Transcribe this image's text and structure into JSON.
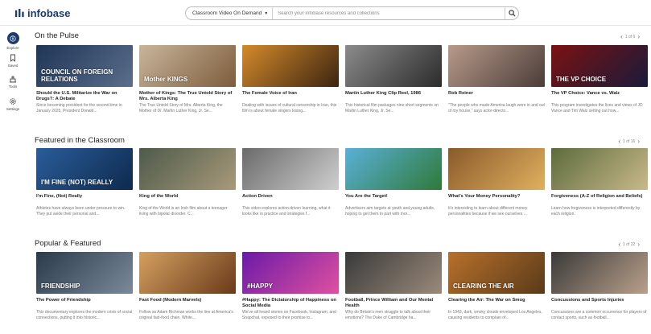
{
  "app": {
    "brand": "infobase"
  },
  "search": {
    "scope": "Classroom Video On Demand",
    "placeholder": "Search your Infobase resources and collections"
  },
  "sidebar": {
    "items": [
      {
        "label": "Explore",
        "icon": "compass-icon",
        "active": true
      },
      {
        "label": "Saved",
        "icon": "bookmark-icon",
        "active": false
      },
      {
        "label": "Tools",
        "icon": "tools-icon",
        "active": false
      },
      {
        "label": "Settings",
        "icon": "gear-icon",
        "active": false
      }
    ]
  },
  "sections": [
    {
      "title": "On the Pulse",
      "pager": "1 of 6",
      "cards": [
        {
          "title": "Should the U.S. Militarize the War on Drugs?: A Debate",
          "desc": "Since becoming president for the second time in January 2025, President Donald...",
          "colors": [
            "#1f3556",
            "#5b6f8c"
          ],
          "overlay": "COUNCIL ON FOREIGN RELATIONS"
        },
        {
          "title": "Mother of Kings: The True Untold Story of Mrs. Alberta King",
          "desc": "The True Untold Story of Mrs. Alberta King, the Mother of Dr. Martin Luther King, Jr. Se...",
          "colors": [
            "#c9b59b",
            "#7d5c3b"
          ],
          "overlay": "Mother KINGS"
        },
        {
          "title": "The Female Voice of Iran",
          "desc": "Dealing with issues of cultural censorship in Iran, this film is about female singers losing...",
          "colors": [
            "#d48a2c",
            "#3b2410"
          ],
          "overlay": ""
        },
        {
          "title": "Martin Luther King Clip Reel, 1986",
          "desc": "This historical film packages nine short segments on Martin Luther King, Jr. Se...",
          "colors": [
            "#8b8b8b",
            "#2b2b2b"
          ],
          "overlay": ""
        },
        {
          "title": "Rob Reiner",
          "desc": "\"The people who made America laugh were in and out of my house,\" says actor-directo...",
          "colors": [
            "#b89a8a",
            "#4a3c38"
          ],
          "overlay": ""
        },
        {
          "title": "The VP Choice: Vance vs. Walz",
          "desc": "This program investigates the lives and views of JD Vance and Tim Walz setting out how...",
          "colors": [
            "#7a1212",
            "#1a1a3a"
          ],
          "overlay": "THE VP CHOICE"
        }
      ]
    },
    {
      "title": "Featured in the Classroom",
      "pager": "1 of 16",
      "cards": [
        {
          "title": "I'm Fine, (Not) Really",
          "desc": "Athletes have always been under pressure to win. They put aside their personal and...",
          "colors": [
            "#2a5d9a",
            "#0e2a4e"
          ],
          "overlay": "I'M FINE (NOT) REALLY"
        },
        {
          "title": "King of the World",
          "desc": "King of the World is an Irish film about a teenager living with bipolar disorder. C...",
          "colors": [
            "#4e5a4a",
            "#a89a7a"
          ],
          "overlay": ""
        },
        {
          "title": "Action Driven",
          "desc": "This video explores action-driven learning, what it looks like in practice and strategies f...",
          "colors": [
            "#6a6a6a",
            "#cfcfcf"
          ],
          "overlay": ""
        },
        {
          "title": "You Are the Target!",
          "desc": "Advertisers aim targets at youth and young adults, hoping to get them to part with mor...",
          "colors": [
            "#5ab0d8",
            "#2f7a3a"
          ],
          "overlay": ""
        },
        {
          "title": "What's Your Money Personality?",
          "desc": "It's interesting to learn about different money personalities because if we see ourselves ...",
          "colors": [
            "#8a5a2a",
            "#e0b060"
          ],
          "overlay": ""
        },
        {
          "title": "Forgiveness (A-Z of Religion and Beliefs)",
          "desc": "Learn how forgiveness is interpreted differently by each religion.",
          "colors": [
            "#5c6b3c",
            "#c9b98a"
          ],
          "overlay": ""
        }
      ]
    },
    {
      "title": "Popular & Featured",
      "pager": "1 of 22",
      "cards": [
        {
          "title": "The Power of Friendship",
          "desc": "This documentary explores the modern crisis of social connections, putting it into historic...",
          "colors": [
            "#2a3a4a",
            "#7a8a9a"
          ],
          "overlay": "FRIENDSHIP"
        },
        {
          "title": "Fast Food (Modern Marvels)",
          "desc": "Follow as Adam Richman works the line at America's original fast-food chain, White...",
          "colors": [
            "#d4a060",
            "#6a3a1a"
          ],
          "overlay": ""
        },
        {
          "title": "#Happy: The Dictatorship of Happiness on Social Media",
          "desc": "We've all heard stories on Facebook, Instagram, and Snapchat, exposed to their promise to...",
          "colors": [
            "#6a1aa8",
            "#e050a0"
          ],
          "overlay": "#HAPPY"
        },
        {
          "title": "Football, Prince William and Our Mental Health",
          "desc": "Why do Britain's men struggle to talk about their emotions? The Duke of Cambridge ha...",
          "colors": [
            "#3a3a3a",
            "#9a8a7a"
          ],
          "overlay": ""
        },
        {
          "title": "Clearing the Air: The War on Smog",
          "desc": "In 1943, dark, smoky clouds enveloped Los Angeles, causing residents to complain of...",
          "colors": [
            "#b8702a",
            "#5a3a1a"
          ],
          "overlay": "CLEARING THE AIR"
        },
        {
          "title": "Concussions and Sports Injuries",
          "desc": "Concussions are a common occurrence for players of contact sports, such as football...",
          "colors": [
            "#3a3a3a",
            "#b9a08a"
          ],
          "overlay": ""
        }
      ]
    }
  ]
}
